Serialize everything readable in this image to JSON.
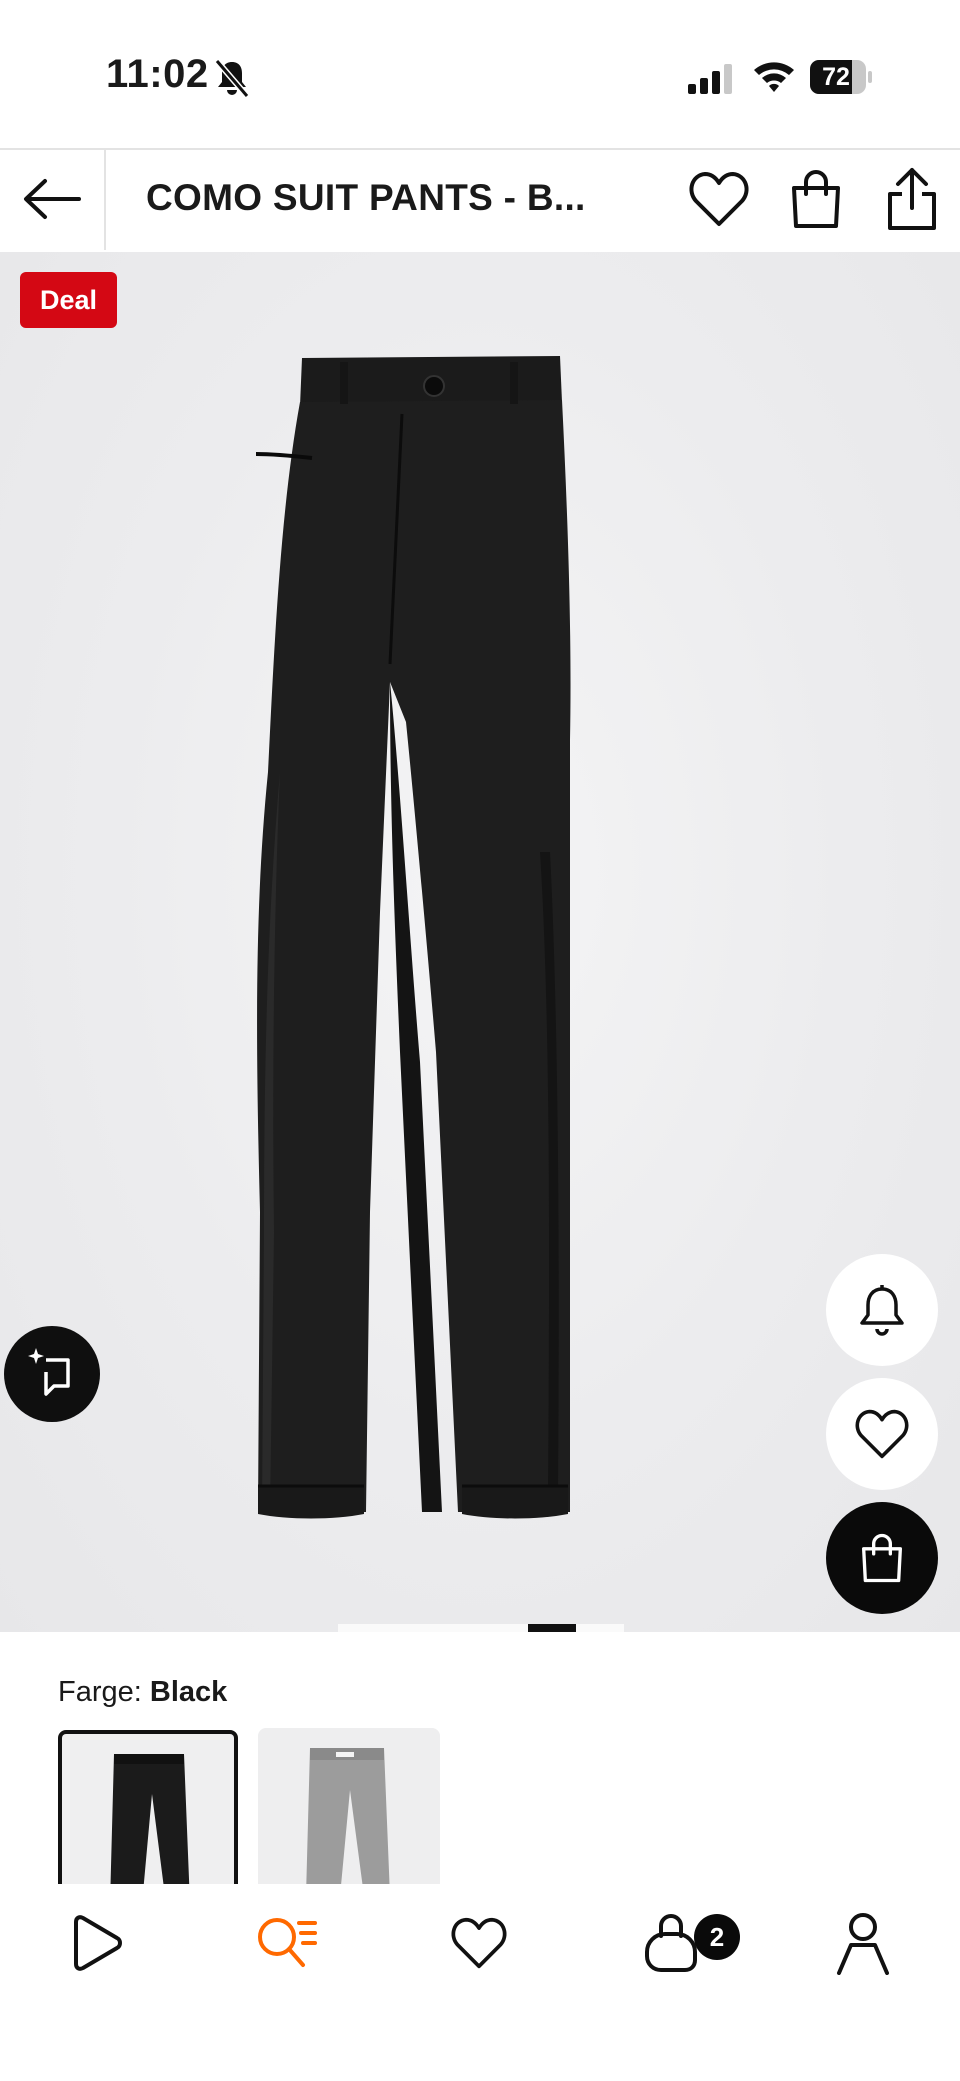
{
  "status_bar": {
    "time": "11:02",
    "battery": "72",
    "icons": [
      "bell-off-icon",
      "signal-icon",
      "wifi-icon",
      "battery-icon"
    ]
  },
  "header": {
    "title": "COMO SUIT PANTS - B...",
    "icons": [
      "back-arrow-icon",
      "heart-icon",
      "bag-icon",
      "share-icon"
    ]
  },
  "product": {
    "badge": "Deal",
    "badge_color": "#d40814",
    "carousel": {
      "current_index": 2,
      "count": 3
    }
  },
  "color_selector": {
    "label": "Farge:",
    "selected": "Black",
    "options": [
      "Black",
      "Grey"
    ]
  },
  "floating_actions": [
    "sparkle-crop-icon",
    "bell-icon",
    "heart-icon",
    "bag-icon"
  ],
  "tab_bar": {
    "items": [
      "play-icon",
      "search-icon",
      "heart-icon",
      "bag-icon",
      "person-icon"
    ],
    "active_color": "#ff6900",
    "bag_count": "2"
  }
}
